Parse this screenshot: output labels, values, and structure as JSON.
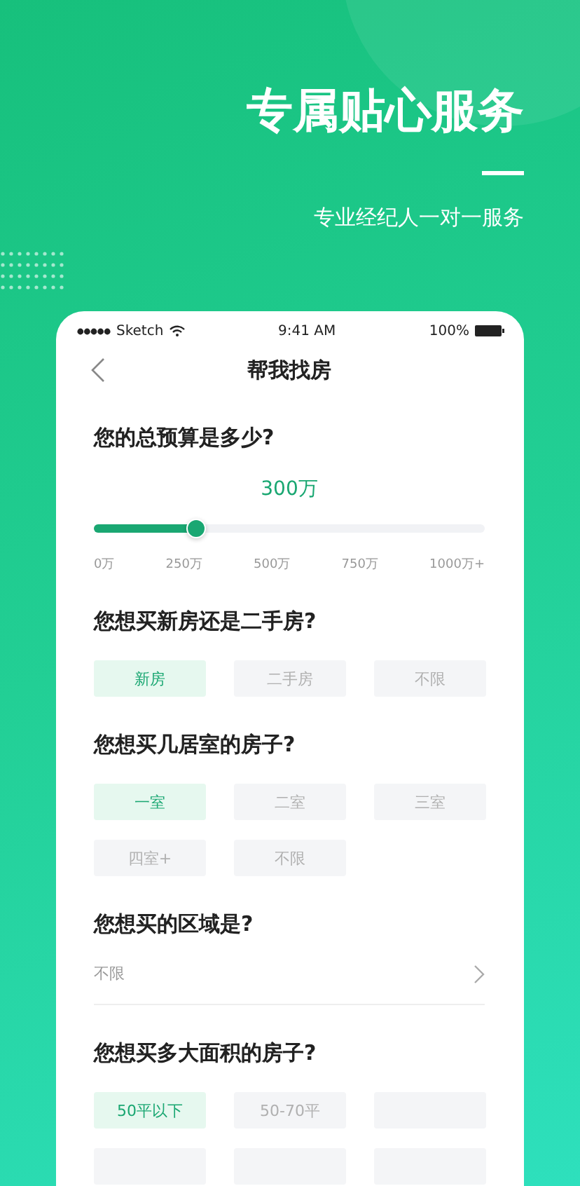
{
  "headline": "专属贴心服务",
  "subtitle": "专业经纪人一对一服务",
  "status_bar": {
    "carrier": "Sketch",
    "time": "9:41 AM",
    "battery": "100%"
  },
  "nav": {
    "title": "帮我找房"
  },
  "budget": {
    "question": "您的总预算是多少?",
    "value": "300万",
    "level": 0.26,
    "ticks": [
      "0万",
      "250万",
      "500万",
      "750万",
      "1000万+"
    ]
  },
  "house_type": {
    "question": "您想买新房还是二手房?",
    "options": [
      {
        "label": "新房",
        "selected": true
      },
      {
        "label": "二手房",
        "selected": false
      },
      {
        "label": "不限",
        "selected": false
      }
    ]
  },
  "rooms": {
    "question": "您想买几居室的房子?",
    "options": [
      {
        "label": "一室",
        "selected": true
      },
      {
        "label": "二室",
        "selected": false
      },
      {
        "label": "三室",
        "selected": false
      },
      {
        "label": "四室+",
        "selected": false
      },
      {
        "label": "不限",
        "selected": false
      }
    ]
  },
  "area": {
    "question": "您想买的区域是?",
    "value": "不限"
  },
  "size": {
    "question": "您想买多大面积的房子?",
    "options": [
      {
        "label": "50平以下",
        "selected": true
      },
      {
        "label": "50-70平",
        "selected": false
      }
    ]
  }
}
